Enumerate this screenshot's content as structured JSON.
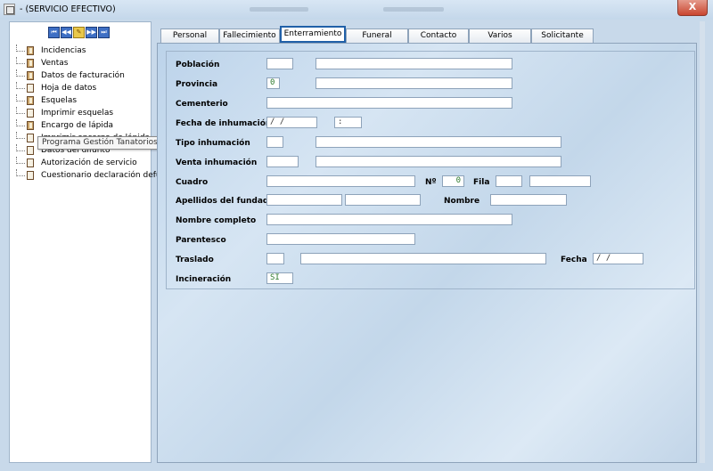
{
  "window": {
    "title": "- (SERVICIO EFECTIVO)",
    "close_label": "X"
  },
  "nav": {
    "buttons": [
      "⏮",
      "◀◀",
      "✎",
      "▶▶",
      "⏭"
    ]
  },
  "tree": {
    "items": [
      {
        "label": "Incidencias",
        "icon": "book-icon"
      },
      {
        "label": "Ventas",
        "icon": "book-icon"
      },
      {
        "label": "Datos de facturación",
        "icon": "book-icon"
      },
      {
        "label": "Hoja de datos",
        "icon": "document-icon"
      },
      {
        "label": "Esquelas",
        "icon": "book-icon"
      },
      {
        "label": "Imprimir esquelas",
        "icon": "document-icon"
      },
      {
        "label": "Encargo de lápida",
        "icon": "book-icon"
      },
      {
        "label": "Imprimir encargo de lápida",
        "icon": "document-icon"
      },
      {
        "label": "Datos del difunto",
        "icon": "document-icon"
      },
      {
        "label": "Autorización de servicio",
        "icon": "document-icon"
      },
      {
        "label": "Cuestionario declaración defu",
        "icon": "document-icon"
      }
    ],
    "tooltip": "Programa Gestión Tanatorios"
  },
  "tabs": [
    "Personal",
    "Fallecimiento",
    "Enterramiento",
    "Funeral",
    "Contacto",
    "Varios",
    "Solicitante"
  ],
  "active_tab": "Enterramiento",
  "form": {
    "poblacion_label": "Población",
    "provincia_label": "Provincia",
    "provincia_code": "0",
    "cementerio_label": "Cementerio",
    "fecha_inhumacion_label": "Fecha de inhumación",
    "fecha_inhumacion_date": "  /  /",
    "fecha_inhumacion_time": " :",
    "tipo_inhumacion_label": "Tipo inhumación",
    "venta_inhumacion_label": "Venta inhumación",
    "cuadro_label": "Cuadro",
    "numero_label": "Nº",
    "numero_value": "0",
    "fila_label": "Fila",
    "apellidos_fundador_label": "Apellidos del fundador",
    "nombre_label": "Nombre",
    "nombre_completo_label": "Nombre completo",
    "parentesco_label": "Parentesco",
    "traslado_label": "Traslado",
    "fecha_label": "Fecha",
    "traslado_fecha": "  /  /",
    "incineracion_label": "Incineración",
    "incineracion_value": "SI"
  },
  "colors": {
    "active_tab_border": "#2060a8",
    "field_text": "#2d7a2d",
    "panel_bg": "#c8d9ea"
  }
}
